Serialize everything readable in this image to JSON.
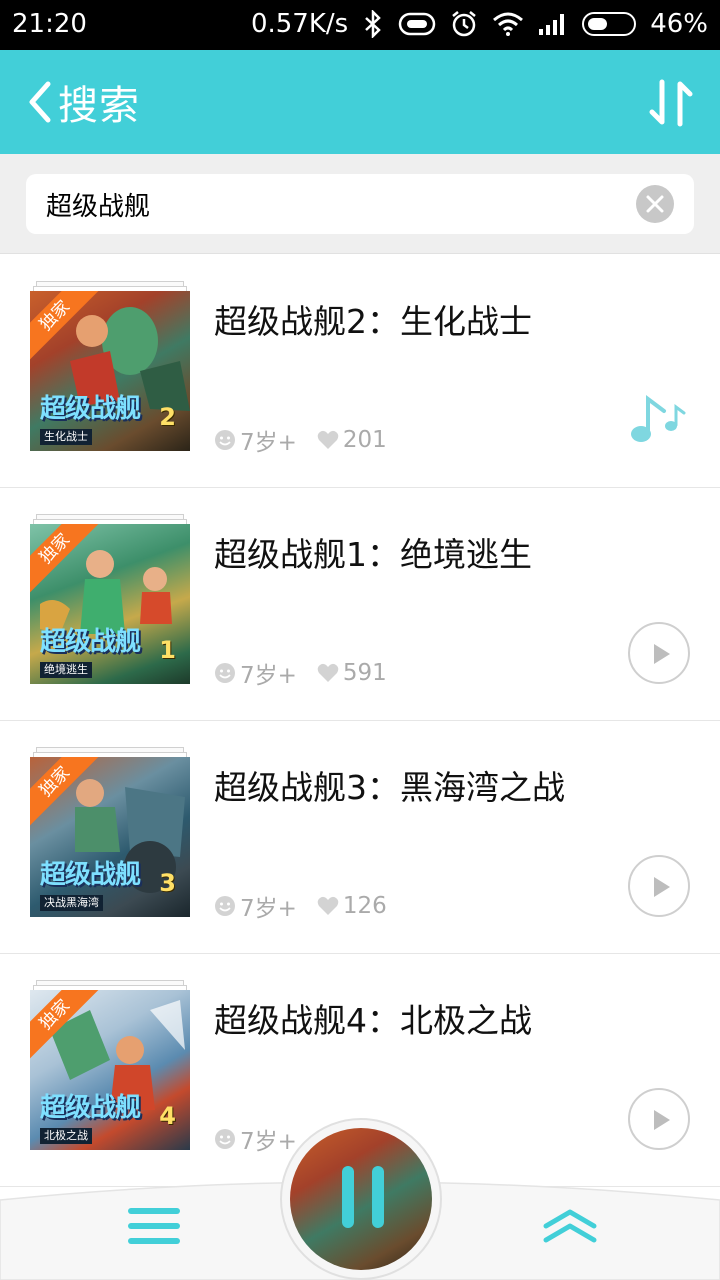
{
  "status_bar": {
    "time": "21:20",
    "net_speed": "0.57K/s",
    "battery": "46%",
    "battery_level": 0.46
  },
  "header": {
    "title": "搜索",
    "back_icon": "chevron-left-icon",
    "sort_icon": "sort-arrows-icon",
    "bg_color": "#42cfd8"
  },
  "search": {
    "value": "超级战舰",
    "clear_icon": "clear-icon"
  },
  "results": [
    {
      "title": "超级战舰2：生化战士",
      "badge": "独家",
      "cover_title": "超级战舰",
      "cover_vol": "2",
      "cover_sub": "生化战士",
      "age": "7岁+",
      "likes": "201",
      "action": "music-icon"
    },
    {
      "title": "超级战舰1：绝境逃生",
      "badge": "独家",
      "cover_title": "超级战舰",
      "cover_vol": "1",
      "cover_sub": "绝境逃生",
      "age": "7岁+",
      "likes": "591",
      "action": "play-icon"
    },
    {
      "title": "超级战舰3：黑海湾之战",
      "badge": "独家",
      "cover_title": "超级战舰",
      "cover_vol": "3",
      "cover_sub": "决战黑海湾",
      "age": "7岁+",
      "likes": "126",
      "action": "play-icon"
    },
    {
      "title": "超级战舰4：北极之战",
      "badge": "独家",
      "cover_title": "超级战舰",
      "cover_vol": "4",
      "cover_sub": "北极之战",
      "age": "7岁+",
      "likes": "",
      "action": "play-icon"
    }
  ],
  "bottom_bar": {
    "menu_icon": "menu-icon",
    "up_icon": "double-chevron-up-icon",
    "player_icon": "pause-icon",
    "accent_color": "#42cfd8"
  }
}
